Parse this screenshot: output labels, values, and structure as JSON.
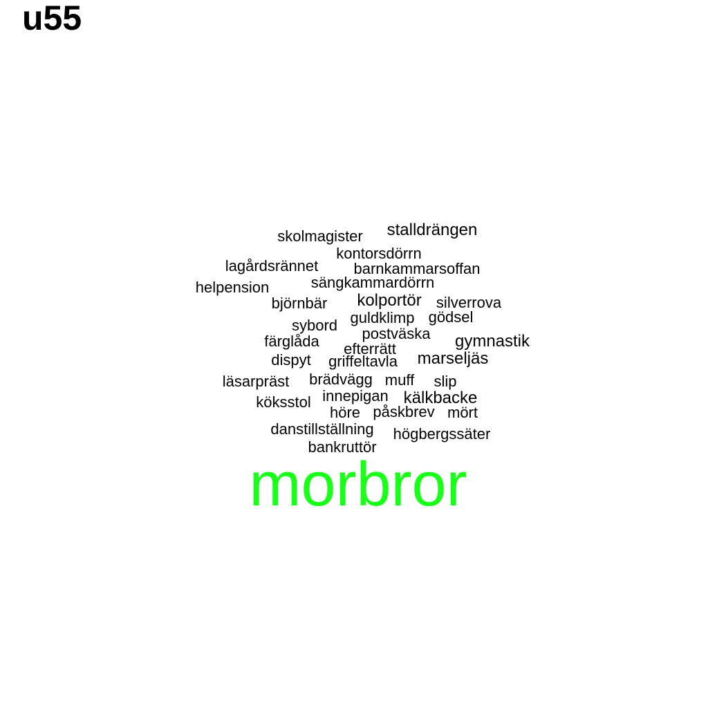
{
  "title": "u55",
  "colors": {
    "text": "#000000",
    "accent": "#1aff1a",
    "background": "#ffffff"
  },
  "words": [
    {
      "text": "skolmagister",
      "weight": 1
    },
    {
      "text": "stalldrängen",
      "weight": 1
    },
    {
      "text": "kontorsdörrn",
      "weight": 1
    },
    {
      "text": "lagårdsrännet",
      "weight": 1
    },
    {
      "text": "barnkammarsoffan",
      "weight": 1
    },
    {
      "text": "helpension",
      "weight": 1
    },
    {
      "text": "sängkammardörrn",
      "weight": 1
    },
    {
      "text": "björnbär",
      "weight": 1
    },
    {
      "text": "kolportör",
      "weight": 1
    },
    {
      "text": "silverrova",
      "weight": 1
    },
    {
      "text": "guldklimp",
      "weight": 1
    },
    {
      "text": "gödsel",
      "weight": 1
    },
    {
      "text": "sybord",
      "weight": 1
    },
    {
      "text": "postväska",
      "weight": 1
    },
    {
      "text": "färglåda",
      "weight": 1
    },
    {
      "text": "gymnastik",
      "weight": 1
    },
    {
      "text": "efterrätt",
      "weight": 1
    },
    {
      "text": "dispyt",
      "weight": 1
    },
    {
      "text": "griffeltavla",
      "weight": 1
    },
    {
      "text": "marseljäs",
      "weight": 1
    },
    {
      "text": "läsarpräst",
      "weight": 1
    },
    {
      "text": "brädvägg",
      "weight": 1
    },
    {
      "text": "muff",
      "weight": 1
    },
    {
      "text": "slip",
      "weight": 1
    },
    {
      "text": "köksstol",
      "weight": 1
    },
    {
      "text": "innepigan",
      "weight": 1
    },
    {
      "text": "kälkbacke",
      "weight": 1
    },
    {
      "text": "höre",
      "weight": 1
    },
    {
      "text": "påskbrev",
      "weight": 1
    },
    {
      "text": "mört",
      "weight": 1
    },
    {
      "text": "danstillställning",
      "weight": 1
    },
    {
      "text": "högbergssäter",
      "weight": 1
    },
    {
      "text": "bankruttör",
      "weight": 1
    },
    {
      "text": "morbror",
      "weight": 4
    }
  ]
}
